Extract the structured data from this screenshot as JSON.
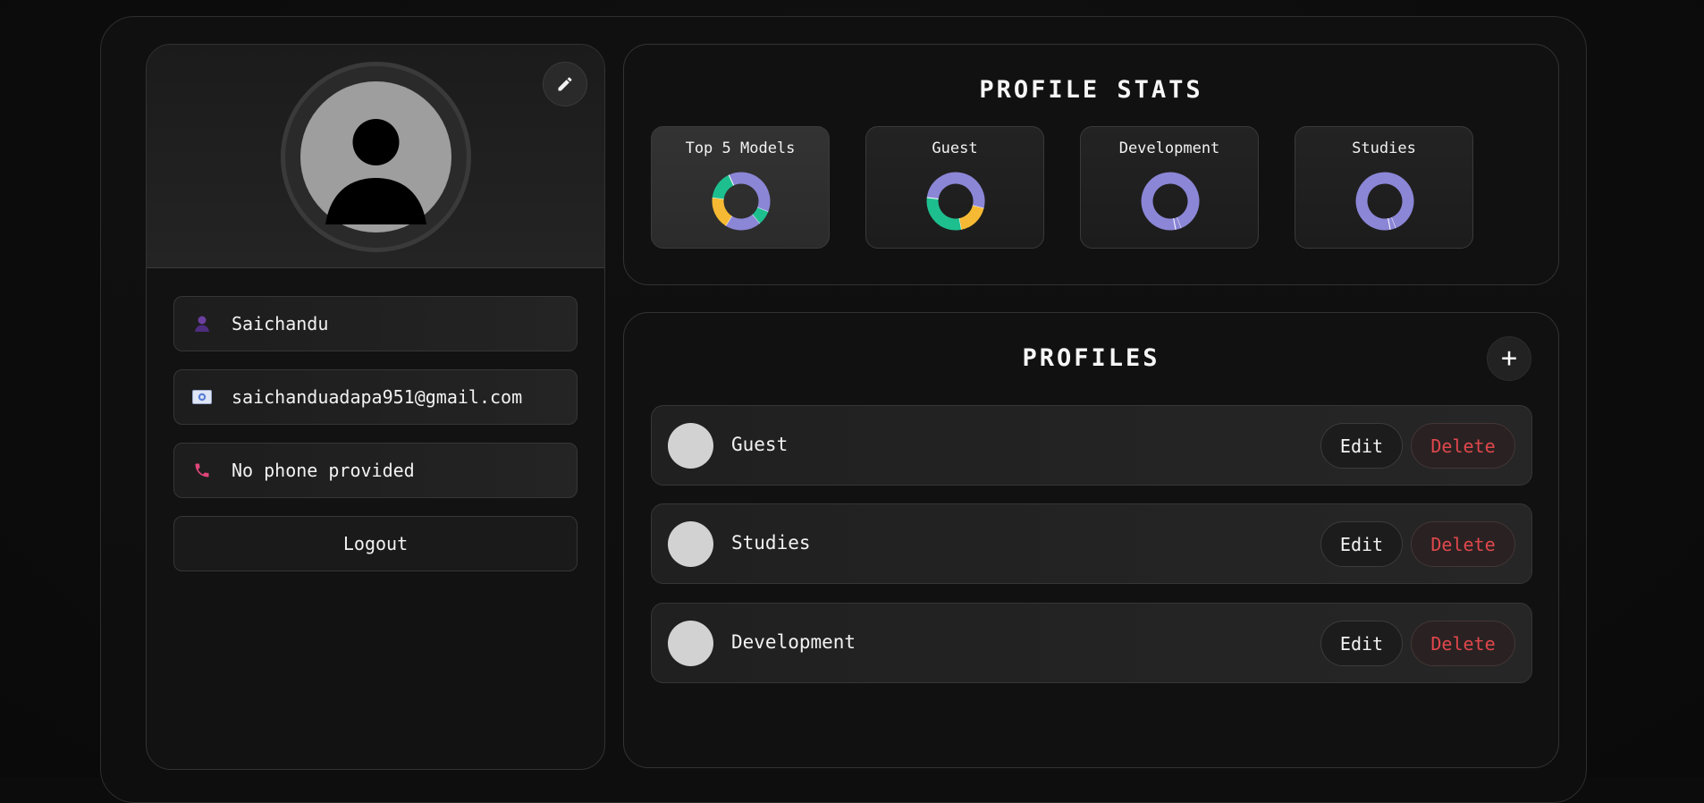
{
  "user": {
    "name": "Saichandu",
    "email": "saichanduadapa951@gmail.com",
    "phone": "No phone provided",
    "logout_label": "Logout"
  },
  "stats": {
    "title": "PROFILE STATS",
    "tiles": [
      {
        "label": "Top 5 Models",
        "active": true
      },
      {
        "label": "Guest",
        "active": false
      },
      {
        "label": "Development",
        "active": false
      },
      {
        "label": "Studies",
        "active": false
      }
    ]
  },
  "profiles": {
    "title": "PROFILES",
    "add_label": "+",
    "items": [
      {
        "name": "Guest",
        "edit_label": "Edit",
        "delete_label": "Delete"
      },
      {
        "name": "Studies",
        "edit_label": "Edit",
        "delete_label": "Delete"
      },
      {
        "name": "Development",
        "edit_label": "Edit",
        "delete_label": "Delete"
      }
    ]
  },
  "colors": {
    "donut_purple": "#8b86d6",
    "donut_green": "#1ebf8f",
    "donut_yellow": "#f5b933",
    "delete_red": "#e0474c",
    "user_icon": "#6b3fa0",
    "phone_icon": "#e0457a"
  },
  "icons": {
    "edit": "pencil-icon",
    "name": "user-icon",
    "email": "id-card-icon",
    "phone": "phone-icon"
  },
  "chart_data": [
    {
      "type": "pie",
      "title": "Top 5 Models",
      "series": [
        {
          "values": [
            0.38,
            0.08,
            0.2,
            0.18,
            0.16
          ]
        }
      ]
    },
    {
      "type": "pie",
      "title": "Guest",
      "series": [
        {
          "values": [
            0.52,
            0.18,
            0.3
          ]
        }
      ]
    },
    {
      "type": "pie",
      "title": "Development",
      "series": [
        {
          "values": [
            0.97,
            0.03
          ]
        }
      ]
    },
    {
      "type": "pie",
      "title": "Studies",
      "series": [
        {
          "values": [
            0.97,
            0.03
          ]
        }
      ]
    }
  ]
}
